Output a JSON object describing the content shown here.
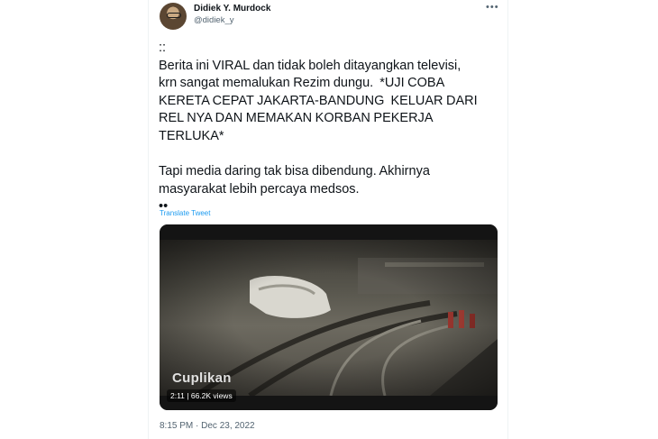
{
  "author": {
    "display_name": "Didiek Y. Murdock",
    "handle": "@didiek_y",
    "avatar_icon": "user-avatar-photo"
  },
  "tweet": {
    "text": "::\nBerita ini VIRAL dan tidak boleh ditayangkan televisi,\nkrn sangat memalukan Rezim dungu.  *UJI COBA\nKERETA CEPAT JAKARTA-BANDUNG  KELUAR DARI\nREL NYA DAN MEMAKAN KORBAN PEKERJA\nTERLUKA*\n\nTapi media daring tak bisa dibendung. Akhirnya\nmasyarakat lebih percaya medsos.\n••",
    "translate_label": "Translate Tweet",
    "timestamp": "8:15 PM · Dec 23, 2022",
    "more_icon": "more-options-icon"
  },
  "video": {
    "overlay_caption": "Cuplikan",
    "duration": "2:11",
    "views": "66.2K views",
    "meta_separator": " | "
  },
  "colors": {
    "text_primary": "#0f1419",
    "text_secondary": "#536471",
    "link": "#1d9bf0"
  }
}
